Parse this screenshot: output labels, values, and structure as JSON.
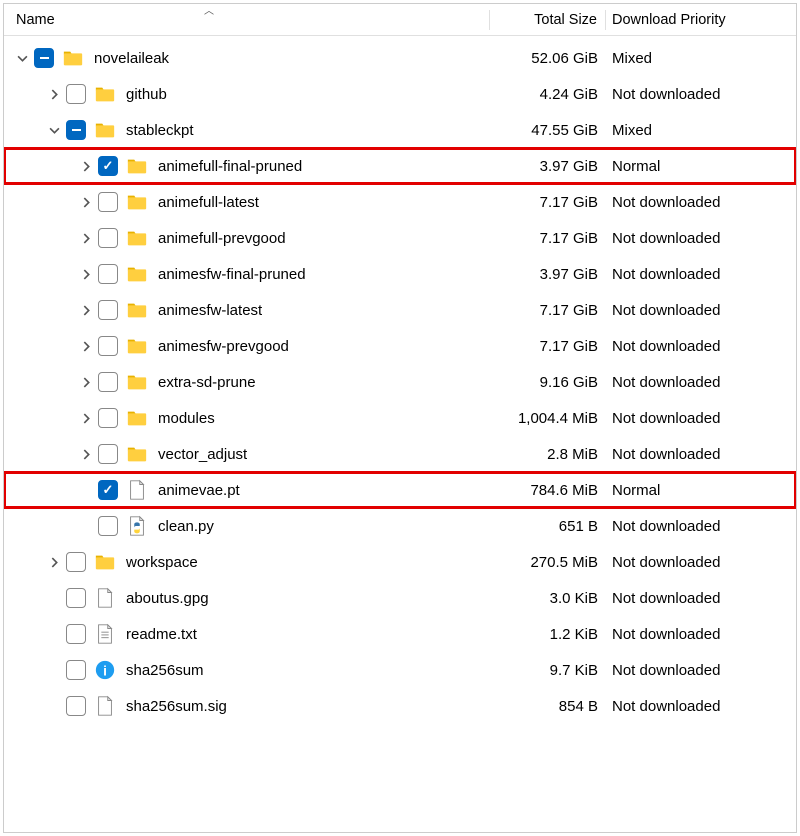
{
  "columns": {
    "name": "Name",
    "size": "Total Size",
    "priority": "Download Priority"
  },
  "rows": [
    {
      "depth": 0,
      "toggle": "down",
      "check": "partial",
      "icon": "folder",
      "name": "novelaileak",
      "size": "52.06 GiB",
      "priority": "Mixed",
      "highlighted": false
    },
    {
      "depth": 1,
      "toggle": "right",
      "check": "unchecked",
      "icon": "folder",
      "name": "github",
      "size": "4.24 GiB",
      "priority": "Not downloaded",
      "highlighted": false
    },
    {
      "depth": 1,
      "toggle": "down",
      "check": "partial",
      "icon": "folder",
      "name": "stableckpt",
      "size": "47.55 GiB",
      "priority": "Mixed",
      "highlighted": false
    },
    {
      "depth": 2,
      "toggle": "right",
      "check": "checked",
      "icon": "folder",
      "name": "animefull-final-pruned",
      "size": "3.97 GiB",
      "priority": "Normal",
      "highlighted": true
    },
    {
      "depth": 2,
      "toggle": "right",
      "check": "unchecked",
      "icon": "folder",
      "name": "animefull-latest",
      "size": "7.17 GiB",
      "priority": "Not downloaded",
      "highlighted": false
    },
    {
      "depth": 2,
      "toggle": "right",
      "check": "unchecked",
      "icon": "folder",
      "name": "animefull-prevgood",
      "size": "7.17 GiB",
      "priority": "Not downloaded",
      "highlighted": false
    },
    {
      "depth": 2,
      "toggle": "right",
      "check": "unchecked",
      "icon": "folder",
      "name": "animesfw-final-pruned",
      "size": "3.97 GiB",
      "priority": "Not downloaded",
      "highlighted": false
    },
    {
      "depth": 2,
      "toggle": "right",
      "check": "unchecked",
      "icon": "folder",
      "name": "animesfw-latest",
      "size": "7.17 GiB",
      "priority": "Not downloaded",
      "highlighted": false
    },
    {
      "depth": 2,
      "toggle": "right",
      "check": "unchecked",
      "icon": "folder",
      "name": "animesfw-prevgood",
      "size": "7.17 GiB",
      "priority": "Not downloaded",
      "highlighted": false
    },
    {
      "depth": 2,
      "toggle": "right",
      "check": "unchecked",
      "icon": "folder",
      "name": "extra-sd-prune",
      "size": "9.16 GiB",
      "priority": "Not downloaded",
      "highlighted": false
    },
    {
      "depth": 2,
      "toggle": "right",
      "check": "unchecked",
      "icon": "folder",
      "name": "modules",
      "size": "1,004.4 MiB",
      "priority": "Not downloaded",
      "highlighted": false
    },
    {
      "depth": 2,
      "toggle": "right",
      "check": "unchecked",
      "icon": "folder",
      "name": "vector_adjust",
      "size": "2.8 MiB",
      "priority": "Not downloaded",
      "highlighted": false
    },
    {
      "depth": 2,
      "toggle": "none",
      "check": "checked",
      "icon": "file",
      "name": "animevae.pt",
      "size": "784.6 MiB",
      "priority": "Normal",
      "highlighted": true
    },
    {
      "depth": 2,
      "toggle": "none",
      "check": "unchecked",
      "icon": "python",
      "name": "clean.py",
      "size": "651 B",
      "priority": "Not downloaded",
      "highlighted": false
    },
    {
      "depth": 1,
      "toggle": "right",
      "check": "unchecked",
      "icon": "folder",
      "name": "workspace",
      "size": "270.5 MiB",
      "priority": "Not downloaded",
      "highlighted": false
    },
    {
      "depth": 1,
      "toggle": "none",
      "check": "unchecked",
      "icon": "file",
      "name": "aboutus.gpg",
      "size": "3.0 KiB",
      "priority": "Not downloaded",
      "highlighted": false
    },
    {
      "depth": 1,
      "toggle": "none",
      "check": "unchecked",
      "icon": "text",
      "name": "readme.txt",
      "size": "1.2 KiB",
      "priority": "Not downloaded",
      "highlighted": false
    },
    {
      "depth": 1,
      "toggle": "none",
      "check": "unchecked",
      "icon": "info",
      "name": "sha256sum",
      "size": "9.7 KiB",
      "priority": "Not downloaded",
      "highlighted": false
    },
    {
      "depth": 1,
      "toggle": "none",
      "check": "unchecked",
      "icon": "file",
      "name": "sha256sum.sig",
      "size": "854 B",
      "priority": "Not downloaded",
      "highlighted": false
    }
  ]
}
